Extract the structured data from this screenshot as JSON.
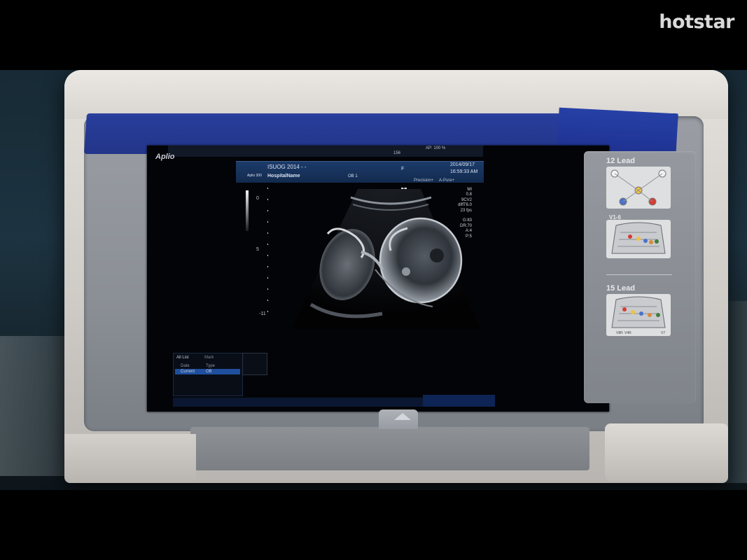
{
  "brand": {
    "logo_text": "hotstar"
  },
  "device": {
    "screen": {
      "app_name": "Aplio",
      "info_bar": {
        "exam_title": "ISUOG 2014 - -",
        "device_model": "Aplio 300",
        "hospital": "HospitalName",
        "preset": "OB 1",
        "sex": "F",
        "date": "2014/09/17",
        "time": "16:59:33 AM"
      },
      "top_status": {
        "heart_rate": "156 ",
        "fps_label": "AP: 100 %"
      },
      "image_settings": {
        "precision": "Precision+",
        "apure": "A-Pure+",
        "transducer_marker": "T"
      },
      "readout_lines": [
        "MI",
        "0.8",
        "9CV2",
        "diffT6.0",
        "23 fps",
        "",
        "G:83",
        "DR:70",
        "A:4",
        "P:5"
      ],
      "depth_labels": [
        "0",
        "5",
        "-11"
      ],
      "list_panel": {
        "tabs": [
          "All List",
          "Mark"
        ],
        "columns": [
          "Date",
          "Type"
        ],
        "rows": [
          {
            "date": "Current",
            "type": "OB"
          }
        ]
      }
    },
    "lead_panel": {
      "section_1": "12 Lead",
      "section_2_label": "V1-6",
      "section_3": "15 Lead",
      "section_3_labels": [
        "V4R",
        "V8R",
        "V7"
      ]
    }
  }
}
